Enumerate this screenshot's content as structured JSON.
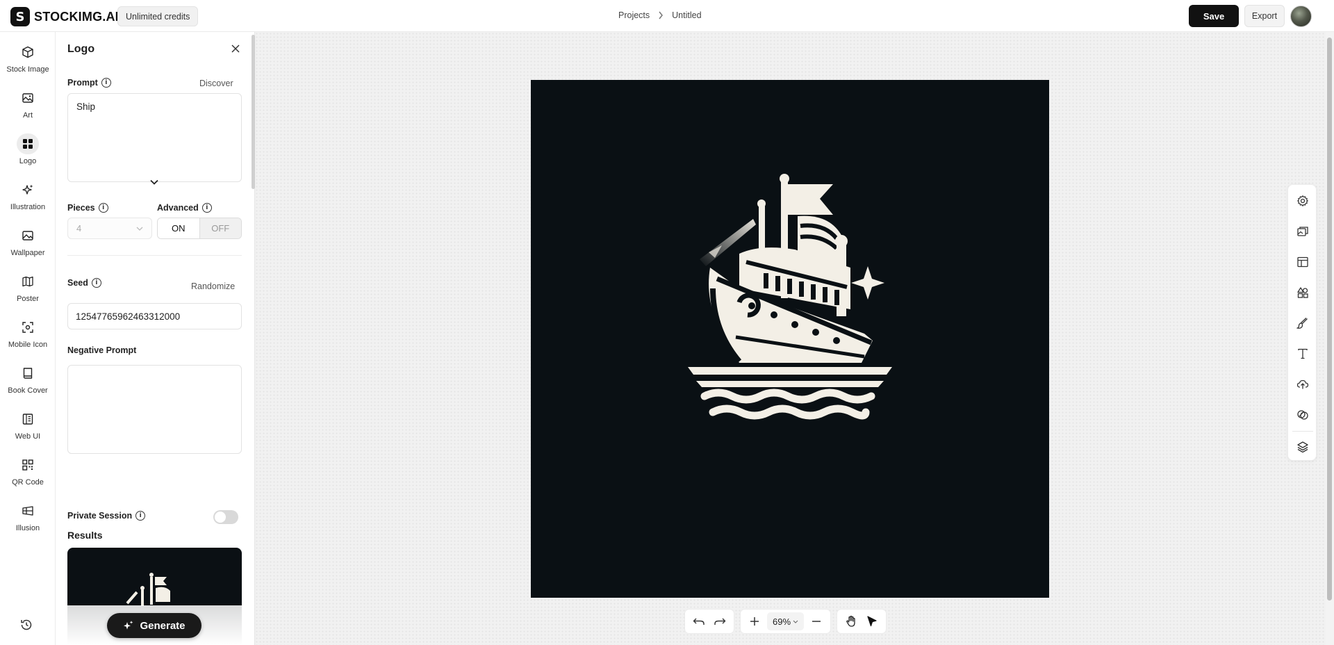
{
  "header": {
    "brand": "STOCKIMG.AI",
    "brand_icon": "S",
    "credits": "Unlimited credits",
    "breadcrumb": [
      "Projects",
      "Untitled"
    ],
    "save_label": "Save",
    "export_label": "Export"
  },
  "nav": {
    "items": [
      {
        "label": "Stock Image",
        "icon": "cube-icon"
      },
      {
        "label": "Art",
        "icon": "image-icon"
      },
      {
        "label": "Logo",
        "icon": "grid-icon",
        "active": true
      },
      {
        "label": "Illustration",
        "icon": "sparkles-icon"
      },
      {
        "label": "Wallpaper",
        "icon": "wallpaper-icon"
      },
      {
        "label": "Poster",
        "icon": "map-icon"
      },
      {
        "label": "Mobile Icon",
        "icon": "focus-icon"
      },
      {
        "label": "Book Cover",
        "icon": "book-icon"
      },
      {
        "label": "Web UI",
        "icon": "layout-icon"
      },
      {
        "label": "QR Code",
        "icon": "qr-icon"
      },
      {
        "label": "Illusion",
        "icon": "illusion-icon"
      }
    ]
  },
  "panel": {
    "title": "Logo",
    "prompt_label": "Prompt",
    "discover_label": "Discover",
    "prompt_value": "Ship",
    "pieces_label": "Pieces",
    "pieces_value": "4",
    "advanced_label": "Advanced",
    "advanced_on": "ON",
    "advanced_off": "OFF",
    "advanced_state": "ON",
    "seed_label": "Seed",
    "randomize_label": "Randomize",
    "seed_value": "12547765962463312000",
    "negative_prompt_label": "Negative Prompt",
    "negative_prompt_value": "",
    "private_session_label": "Private Session",
    "private_session_enabled": false,
    "results_label": "Results",
    "generate_label": "Generate"
  },
  "canvas": {
    "zoom": "69%",
    "background": "#0a1014",
    "logo_color": "#f3efe6"
  }
}
